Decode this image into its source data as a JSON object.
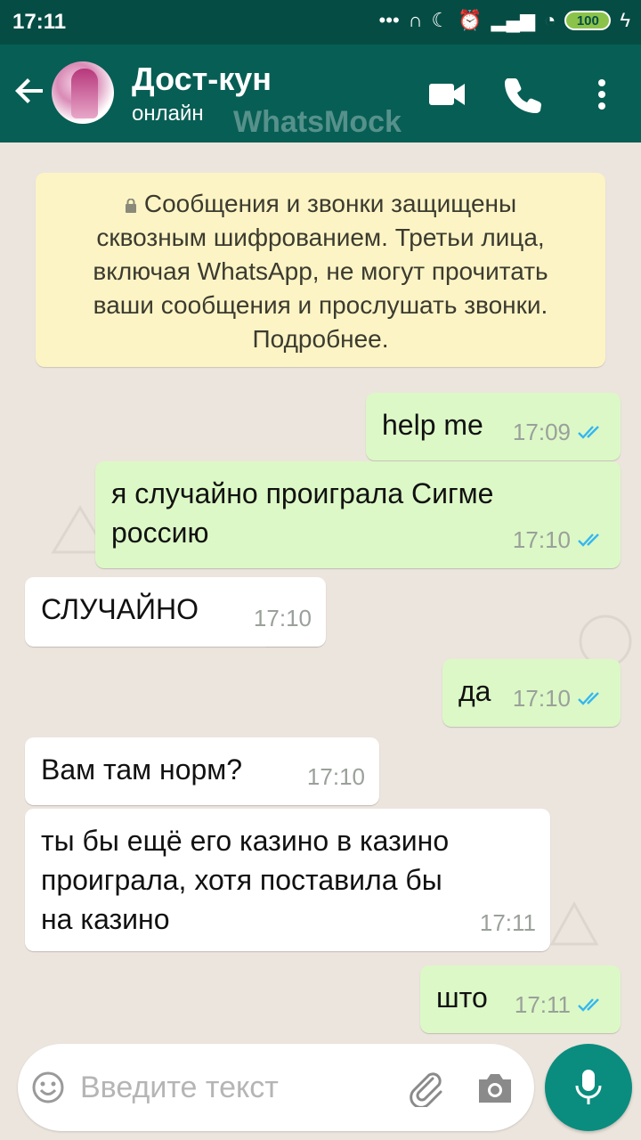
{
  "status_bar": {
    "time": "17:11",
    "battery": "100"
  },
  "header": {
    "name": "Дост-кун",
    "status": "онлайн",
    "watermark": "WhatsMock"
  },
  "encryption_notice": {
    "lines": [
      "Сообщения и звонки защищены",
      "сквозным шифрованием. Третьи лица,",
      "включая WhatsApp, не могут прочитать",
      "ваши сообщения и прослушать звонки.",
      "Подробнее."
    ]
  },
  "messages": [
    {
      "direction": "out",
      "lines": [
        "help me"
      ],
      "time": "17:09",
      "read": true
    },
    {
      "direction": "out",
      "lines": [
        "я случайно проиграла Сигме",
        "россию"
      ],
      "time": "17:10",
      "read": true
    },
    {
      "direction": "in",
      "lines": [
        "СЛУЧАЙНО"
      ],
      "time": "17:10"
    },
    {
      "direction": "out",
      "lines": [
        "да"
      ],
      "time": "17:10",
      "read": true
    },
    {
      "direction": "in",
      "lines": [
        "Вам там норм?"
      ],
      "time": "17:10"
    },
    {
      "direction": "in",
      "lines": [
        "ты бы ещё его казино в казино",
        "проиграла, хотя поставила бы",
        "на казино"
      ],
      "time": "17:11"
    },
    {
      "direction": "out",
      "lines": [
        "што"
      ],
      "time": "17:11",
      "read": true
    }
  ],
  "input": {
    "placeholder": "Введите текст"
  },
  "icons": {
    "back": "arrow-left-icon",
    "video": "video-call-icon",
    "call": "phone-icon",
    "menu": "more-vertical-icon",
    "lock": "lock-icon",
    "emoji": "emoji-icon",
    "attach": "paperclip-icon",
    "camera": "camera-icon",
    "mic": "microphone-icon",
    "read": "double-check-icon"
  },
  "colors": {
    "header": "#075E54",
    "status_bar": "#054D44",
    "chat_bg": "#ECE5DD",
    "outgoing_bubble": "#DCF8C6",
    "incoming_bubble": "#FFFFFF",
    "notice_bg": "#FDF4C5",
    "read_ticks": "#34B7F1",
    "mic_button": "#0A8D7E"
  }
}
